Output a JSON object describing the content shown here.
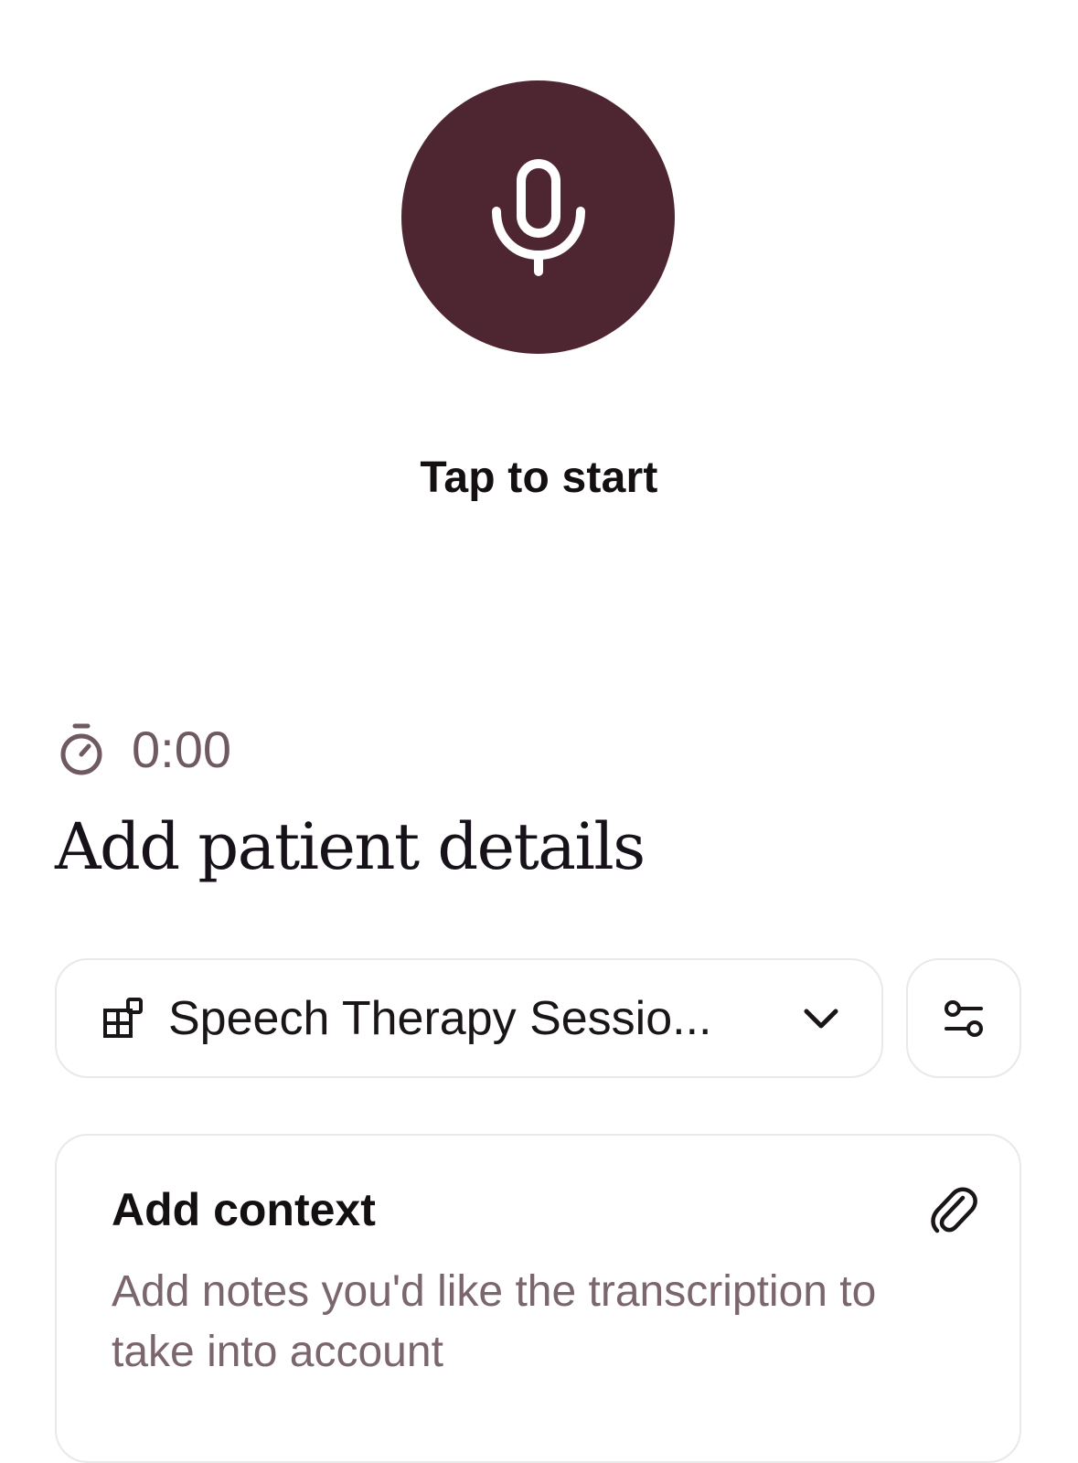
{
  "recorder": {
    "icon": "microphone-icon",
    "tap_label": "Tap to start",
    "accent_color": "#4e2631"
  },
  "timer": {
    "icon": "stopwatch-icon",
    "value": "0:00"
  },
  "page_title": "Add patient details",
  "template_select": {
    "icon": "template-blocks-icon",
    "selected": "Speech Therapy Sessio...",
    "chevron": "chevron-down-icon"
  },
  "settings_button": {
    "icon": "sliders-icon"
  },
  "context": {
    "title": "Add context",
    "attach_icon": "paperclip-icon",
    "placeholder": "Add notes you'd like the transcription to take into account"
  }
}
